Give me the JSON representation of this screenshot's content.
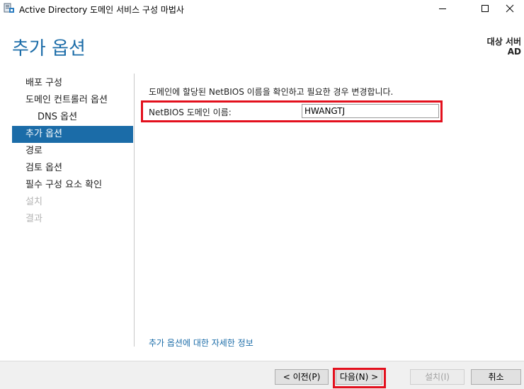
{
  "window": {
    "title": "Active Directory 도메인 서비스 구성 마법사",
    "icons": [
      "server-app-icon",
      "minimize-icon",
      "maximize-icon",
      "close-icon"
    ]
  },
  "header": {
    "page_title": "추가 옵션",
    "target_label": "대상 서버",
    "target_value": "AD"
  },
  "nav": {
    "items": [
      {
        "label": "배포 구성",
        "state": "normal"
      },
      {
        "label": "도메인 컨트롤러 옵션",
        "state": "normal"
      },
      {
        "label": "DNS 옵션",
        "state": "sub"
      },
      {
        "label": "추가 옵션",
        "state": "active"
      },
      {
        "label": "경로",
        "state": "normal"
      },
      {
        "label": "검토 옵션",
        "state": "normal"
      },
      {
        "label": "필수 구성 요소 확인",
        "state": "normal"
      },
      {
        "label": "설치",
        "state": "disabled"
      },
      {
        "label": "결과",
        "state": "disabled"
      }
    ]
  },
  "main": {
    "description": "도메인에 할당된 NetBIOS 이름을 확인하고 필요한 경우 변경합니다.",
    "netbios_label": "NetBIOS 도메인 이름:",
    "netbios_value": "HWANGTJ",
    "more_info_link": "추가 옵션에 대한 자세한 정보"
  },
  "footer": {
    "prev_label": "< 이전(P)",
    "next_label": "다음(N) >",
    "install_label": "설치(I)",
    "cancel_label": "취소"
  },
  "colors": {
    "accent": "#1b6ca8",
    "highlight": "#e3101d",
    "disabled_text": "#b4b4b4"
  }
}
